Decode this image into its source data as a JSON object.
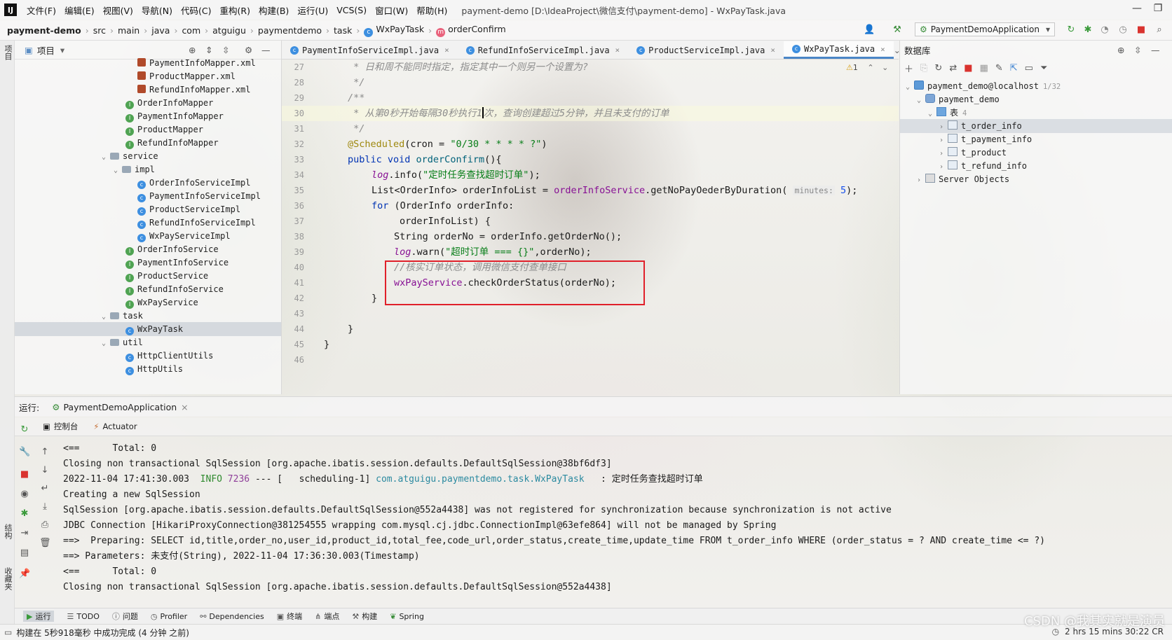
{
  "menubar": {
    "logo": "IJ",
    "items": [
      "文件(F)",
      "编辑(E)",
      "视图(V)",
      "导航(N)",
      "代码(C)",
      "重构(R)",
      "构建(B)",
      "运行(U)",
      "VCS(S)",
      "窗口(W)",
      "帮助(H)"
    ],
    "title": "payment-demo [D:\\IdeaProject\\微信支付\\payment-demo] - WxPayTask.java"
  },
  "navbar": {
    "crumbs": [
      "payment-demo",
      "src",
      "main",
      "java",
      "com",
      "atguigu",
      "paymentdemo",
      "task",
      "WxPayTask",
      "orderConfirm"
    ],
    "run_config": "PaymentDemoApplication"
  },
  "project": {
    "header": "项目",
    "tree": [
      {
        "label": "PaymentInfoMapper.xml",
        "icon": "xml-icon"
      },
      {
        "label": "ProductMapper.xml",
        "icon": "xml-icon"
      },
      {
        "label": "RefundInfoMapper.xml",
        "icon": "xml-icon"
      },
      {
        "label": "OrderInfoMapper",
        "icon": "interface-icon"
      },
      {
        "label": "PaymentInfoMapper",
        "icon": "interface-icon"
      },
      {
        "label": "ProductMapper",
        "icon": "interface-icon"
      },
      {
        "label": "RefundInfoMapper",
        "icon": "interface-icon"
      },
      {
        "label": "service",
        "icon": "folder-icon"
      },
      {
        "label": "impl",
        "icon": "folder-icon"
      },
      {
        "label": "OrderInfoServiceImpl",
        "icon": "class-icon"
      },
      {
        "label": "PaymentInfoServiceImpl",
        "icon": "class-icon"
      },
      {
        "label": "ProductServiceImpl",
        "icon": "class-icon"
      },
      {
        "label": "RefundInfoServiceImpl",
        "icon": "class-icon"
      },
      {
        "label": "WxPayServiceImpl",
        "icon": "class-icon"
      },
      {
        "label": "OrderInfoService",
        "icon": "interface-icon"
      },
      {
        "label": "PaymentInfoService",
        "icon": "interface-icon"
      },
      {
        "label": "ProductService",
        "icon": "interface-icon"
      },
      {
        "label": "RefundInfoService",
        "icon": "interface-icon"
      },
      {
        "label": "WxPayService",
        "icon": "interface-icon"
      },
      {
        "label": "task",
        "icon": "folder-icon"
      },
      {
        "label": "WxPayTask",
        "icon": "class-icon"
      },
      {
        "label": "util",
        "icon": "folder-icon"
      },
      {
        "label": "HttpClientUtils",
        "icon": "class-icon"
      },
      {
        "label": "HttpUtils",
        "icon": "class-icon"
      }
    ]
  },
  "editor": {
    "tabs": [
      "PaymentInfoServiceImpl.java",
      "RefundInfoServiceImpl.java",
      "ProductServiceImpl.java",
      "WxPayTask.java"
    ],
    "active_tab": "WxPayTask.java",
    "warning_count": "1",
    "line_numbers": [
      "27",
      "28",
      "29",
      "30",
      "31",
      "32",
      "33",
      "34",
      "35",
      "36",
      "37",
      "38",
      "39",
      "40",
      "41",
      "42",
      "43",
      "44",
      "45",
      "46"
    ],
    "code": {
      "l27": " * 日和周不能同时指定，指定其中一个则另一个设置为?",
      "l28": " */",
      "l29": "/**",
      "l30a": " * 从第0秒开始每隔30秒执行1",
      "l30b": "次，查询创建超过5分钟，并且未支付的订单",
      "l31": " */",
      "l32_ann": "@Scheduled",
      "l32_rest": "(cron = ",
      "l32_str": "\"0/30 * * * * ?\"",
      "l32_end": ")",
      "l33_kw": "public void ",
      "l33_m": "orderConfirm",
      "l33_end": "(){",
      "l34_fld": "log",
      "l34_rest": ".info(",
      "l34_str": "\"定时任务查找超时订单\"",
      "l34_end": ");",
      "l35_a": "List<OrderInfo> orderInfoList = ",
      "l35_fld": "orderInfoService",
      "l35_b": ".getNoPayOederByDuration(",
      "l35_hint": "minutes:",
      "l35_num": "5",
      "l35_end": ");",
      "l36_kw": "for ",
      "l36_rest": "(OrderInfo orderInfo:",
      "l37": "orderInfoList) {",
      "l38": "String orderNo = orderInfo.getOrderNo();",
      "l39_fld": "log",
      "l39_rest": ".warn(",
      "l39_str": "\"超时订单 === {}\"",
      "l39_end": ",orderNo);",
      "l40": "//核实订单状态，调用微信支付查单接口",
      "l41_fld": "wxPayService",
      "l41_rest": ".checkOrderStatus(orderNo);",
      "l42": "}",
      "l44": "}",
      "l45": "}"
    }
  },
  "database": {
    "header": "数据库",
    "tree": [
      {
        "label": "payment_demo@localhost",
        "count": "1/32"
      },
      {
        "label": "payment_demo",
        "count": ""
      },
      {
        "label": "表",
        "count": "4"
      },
      {
        "label": "t_order_info",
        "count": ""
      },
      {
        "label": "t_payment_info",
        "count": ""
      },
      {
        "label": "t_product",
        "count": ""
      },
      {
        "label": "t_refund_info",
        "count": ""
      },
      {
        "label": "Server Objects",
        "count": ""
      }
    ]
  },
  "run": {
    "label": "运行:",
    "config_tab": "PaymentDemoApplication",
    "subtabs": [
      "控制台",
      "Actuator"
    ],
    "console": {
      "l1": "<==      Total: 0",
      "l2": "Closing non transactional SqlSession [org.apache.ibatis.session.defaults.DefaultSqlSession@38bf6df3]",
      "l3_time": "2022-11-04 17:41:30.003  ",
      "l3_level": "INFO",
      "l3_pid": " 7236",
      "l3_thread": " --- [   scheduling-1] ",
      "l3_cls": "com.atguigu.paymentdemo.task.WxPayTask",
      "l3_msg": "   : 定时任务查找超时订单",
      "l4": "Creating a new SqlSession",
      "l5": "SqlSession [org.apache.ibatis.session.defaults.DefaultSqlSession@552a4438] was not registered for synchronization because synchronization is not active",
      "l6": "JDBC Connection [HikariProxyConnection@381254555 wrapping com.mysql.cj.jdbc.ConnectionImpl@63efe864] will not be managed by Spring",
      "l7": "==>  Preparing: SELECT id,title,order_no,user_id,product_id,total_fee,code_url,order_status,create_time,update_time FROM t_order_info WHERE (order_status = ? AND create_time <= ?)",
      "l8": "==> Parameters: 未支付(String), 2022-11-04 17:36:30.003(Timestamp)",
      "l9": "<==      Total: 0",
      "l10": "Closing non transactional SqlSession [org.apache.ibatis.session.defaults.DefaultSqlSession@552a4438]"
    }
  },
  "bottom_tools": [
    "运行",
    "TODO",
    "问题",
    "Profiler",
    "Dependencies",
    "终端",
    "端点",
    "构建",
    "Spring"
  ],
  "status": {
    "left": "构建在 5秒918毫秒 中成功完成 (4 分钟 之前)",
    "right": "2 hrs 15 mins  30:22  CR",
    "watermark": "CSDN @我其实就是演员"
  },
  "stripe": {
    "left_top": "项目",
    "left_mid": "结构",
    "left_bot": "收藏夹"
  },
  "colors": {
    "keyword": "#0033b3",
    "string": "#067d17",
    "comment": "#8c8c8c",
    "annotation": "#9e880d",
    "field": "#871094",
    "highlight_box": "#e0202a"
  }
}
